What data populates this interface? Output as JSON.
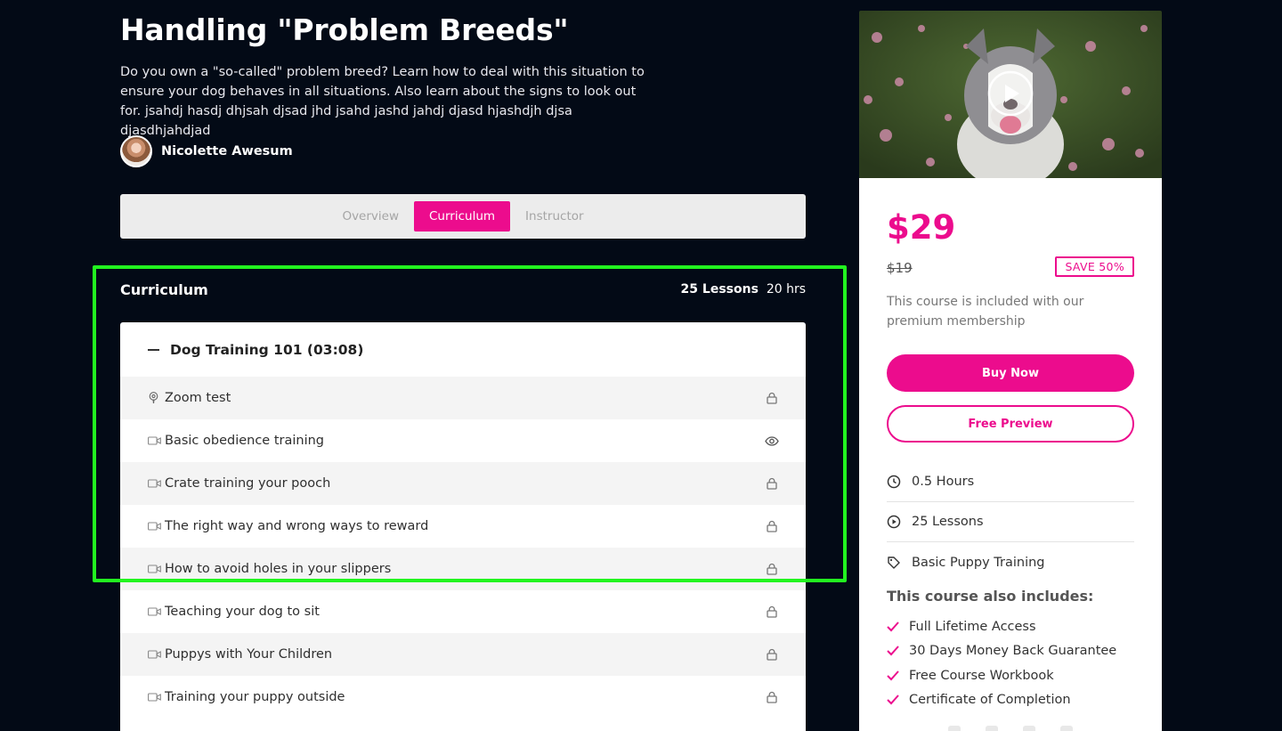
{
  "course": {
    "title": "Handling \"Problem Breeds\"",
    "description": "Do you own a \"so-called\" problem breed? Learn how to deal with this situation to ensure your dog behaves in all situations. Also learn about the signs to look out for. jsahdj hasdj dhjsah djsad jhd jsahd jashd jahdj djasd hjashdjh djsa djasdhjahdjad",
    "author": "Nicolette Awesum"
  },
  "tabs": [
    {
      "label": "Overview",
      "active": false
    },
    {
      "label": "Curriculum",
      "active": true
    },
    {
      "label": "Instructor",
      "active": false
    }
  ],
  "curriculum": {
    "title": "Curriculum",
    "lessons_count": "25 Lessons",
    "hours": "20 hrs",
    "section": {
      "title": "Dog Training 101 (03:08)",
      "lessons": [
        {
          "name": "Zoom test",
          "type": "podcast-icon",
          "status": "lock-icon"
        },
        {
          "name": "Basic obedience training",
          "type": "video-icon",
          "status": "eye-icon"
        },
        {
          "name": "Crate training your pooch",
          "type": "video-icon",
          "status": "lock-icon"
        },
        {
          "name": "The right way and wrong ways to reward",
          "type": "video-icon",
          "status": "lock-icon"
        },
        {
          "name": "How to avoid holes in your slippers",
          "type": "video-icon",
          "status": "lock-icon"
        },
        {
          "name": "Teaching your dog to sit",
          "type": "video-icon",
          "status": "lock-icon"
        },
        {
          "name": "Puppys with Your Children",
          "type": "video-icon",
          "status": "lock-icon"
        },
        {
          "name": "Training your puppy outside",
          "type": "video-icon",
          "status": "lock-icon"
        }
      ]
    }
  },
  "sidebar": {
    "price": "$29",
    "old_price": "$19",
    "save_badge": "SAVE 50%",
    "membership_note": "This course is included with our premium membership",
    "buy_label": "Buy Now",
    "preview_label": "Free Preview",
    "features": [
      {
        "label": "0.5 Hours",
        "icon": "clock-icon"
      },
      {
        "label": "25 Lessons",
        "icon": "play-circle-icon"
      },
      {
        "label": "Basic Puppy Training",
        "icon": "tag-icon"
      }
    ],
    "includes_title": "This course also includes:",
    "includes": [
      "Full Lifetime Access",
      "30 Days Money Back Guarantee",
      "Free Course Workbook",
      "Certificate of Completion"
    ]
  },
  "colors": {
    "brand": "#ec0c8d",
    "background": "#030a16",
    "highlight": "#22f51f"
  }
}
